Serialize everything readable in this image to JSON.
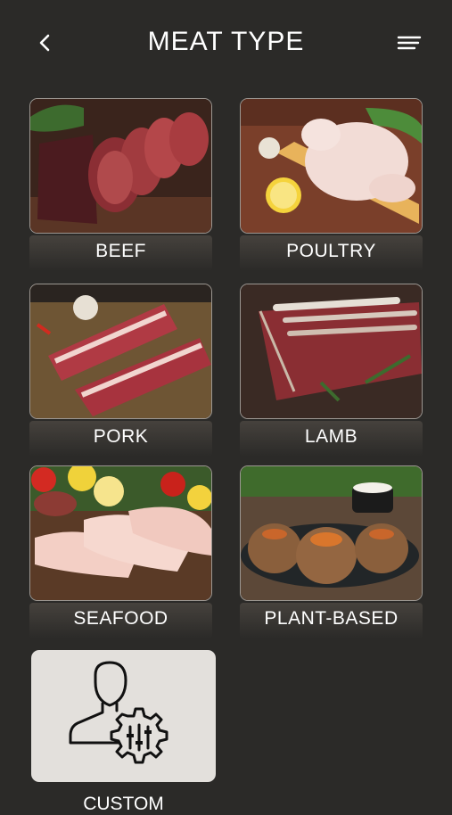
{
  "header": {
    "title": "MEAT TYPE",
    "back_icon": "chevron-left-icon",
    "menu_icon": "menu-icon"
  },
  "meat_types": [
    {
      "label": "BEEF"
    },
    {
      "label": "POULTRY"
    },
    {
      "label": "PORK"
    },
    {
      "label": "LAMB"
    },
    {
      "label": "SEAFOOD"
    },
    {
      "label": "PLANT-BASED"
    }
  ],
  "custom": {
    "label": "CUSTOM",
    "icon": "user-settings-icon"
  },
  "colors": {
    "background": "#2b2a28",
    "custom_tile": "#e3e0dc",
    "text": "#ffffff"
  }
}
